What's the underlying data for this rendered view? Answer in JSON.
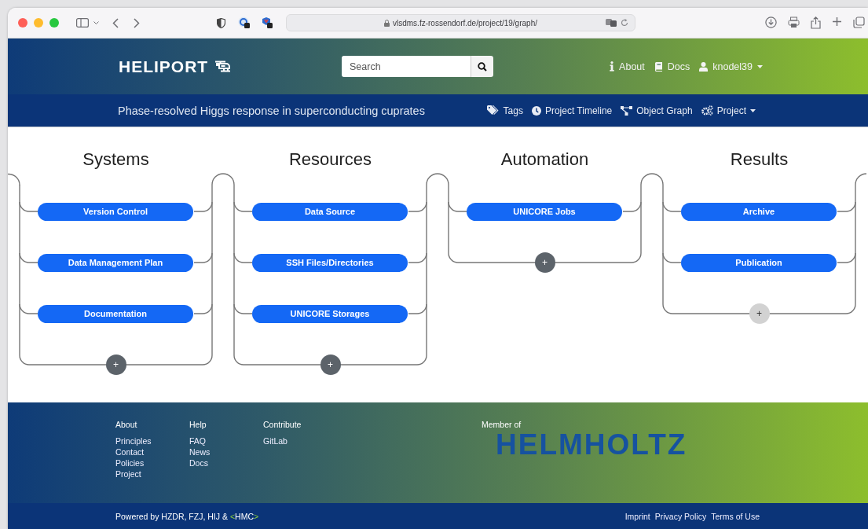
{
  "browser": {
    "url": "vlsdms.fz-rossendorf.de/project/19/graph/"
  },
  "header": {
    "logo": "HELIPORT",
    "search": {
      "placeholder": "Search"
    },
    "nav": [
      {
        "label": "About",
        "kind": "info",
        "dropdown": false
      },
      {
        "label": "Docs",
        "kind": "book",
        "dropdown": false
      },
      {
        "label": "knodel39",
        "kind": "user",
        "dropdown": true
      }
    ]
  },
  "project_bar": {
    "title": "Phase-resolved Higgs response in superconducting cuprates",
    "nav": [
      {
        "label": "Tags",
        "kind": "tags",
        "dropdown": false
      },
      {
        "label": "Project Timeline",
        "kind": "clock",
        "dropdown": false
      },
      {
        "label": "Object Graph",
        "kind": "graph",
        "dropdown": false
      },
      {
        "label": "Project",
        "kind": "cogs",
        "dropdown": true
      }
    ]
  },
  "graph": {
    "columns": [
      {
        "title": "Systems",
        "items": [
          "Version Control",
          "Data Management Plan",
          "Documentation"
        ],
        "add_label": "+",
        "add_disabled": false
      },
      {
        "title": "Resources",
        "items": [
          "Data Source",
          "SSH Files/Directories",
          "UNICORE Storages"
        ],
        "add_label": "+",
        "add_disabled": false
      },
      {
        "title": "Automation",
        "items": [
          "UNICORE Jobs"
        ],
        "add_label": "+",
        "add_disabled": false
      },
      {
        "title": "Results",
        "items": [
          "Archive",
          "Publication"
        ],
        "add_label": "+",
        "add_disabled": true
      }
    ]
  },
  "footer": {
    "columns": [
      {
        "heading": "About",
        "links": [
          "Principles",
          "Contact",
          "Policies",
          "Project"
        ]
      },
      {
        "heading": "Help",
        "links": [
          "FAQ",
          "News",
          "Docs"
        ]
      },
      {
        "heading": "Contribute",
        "links": [
          "GitLab"
        ]
      }
    ],
    "member_label": "Member of",
    "member_logo": "HELMHOLTZ",
    "powered_by": "Powered by HZDR, FZJ, HIJ &",
    "powered_link": {
      "open": "<",
      "name": "HMC",
      "close": ">"
    },
    "legal_links": [
      "Imprint",
      "Privacy Policy",
      "Terms of Use"
    ]
  }
}
